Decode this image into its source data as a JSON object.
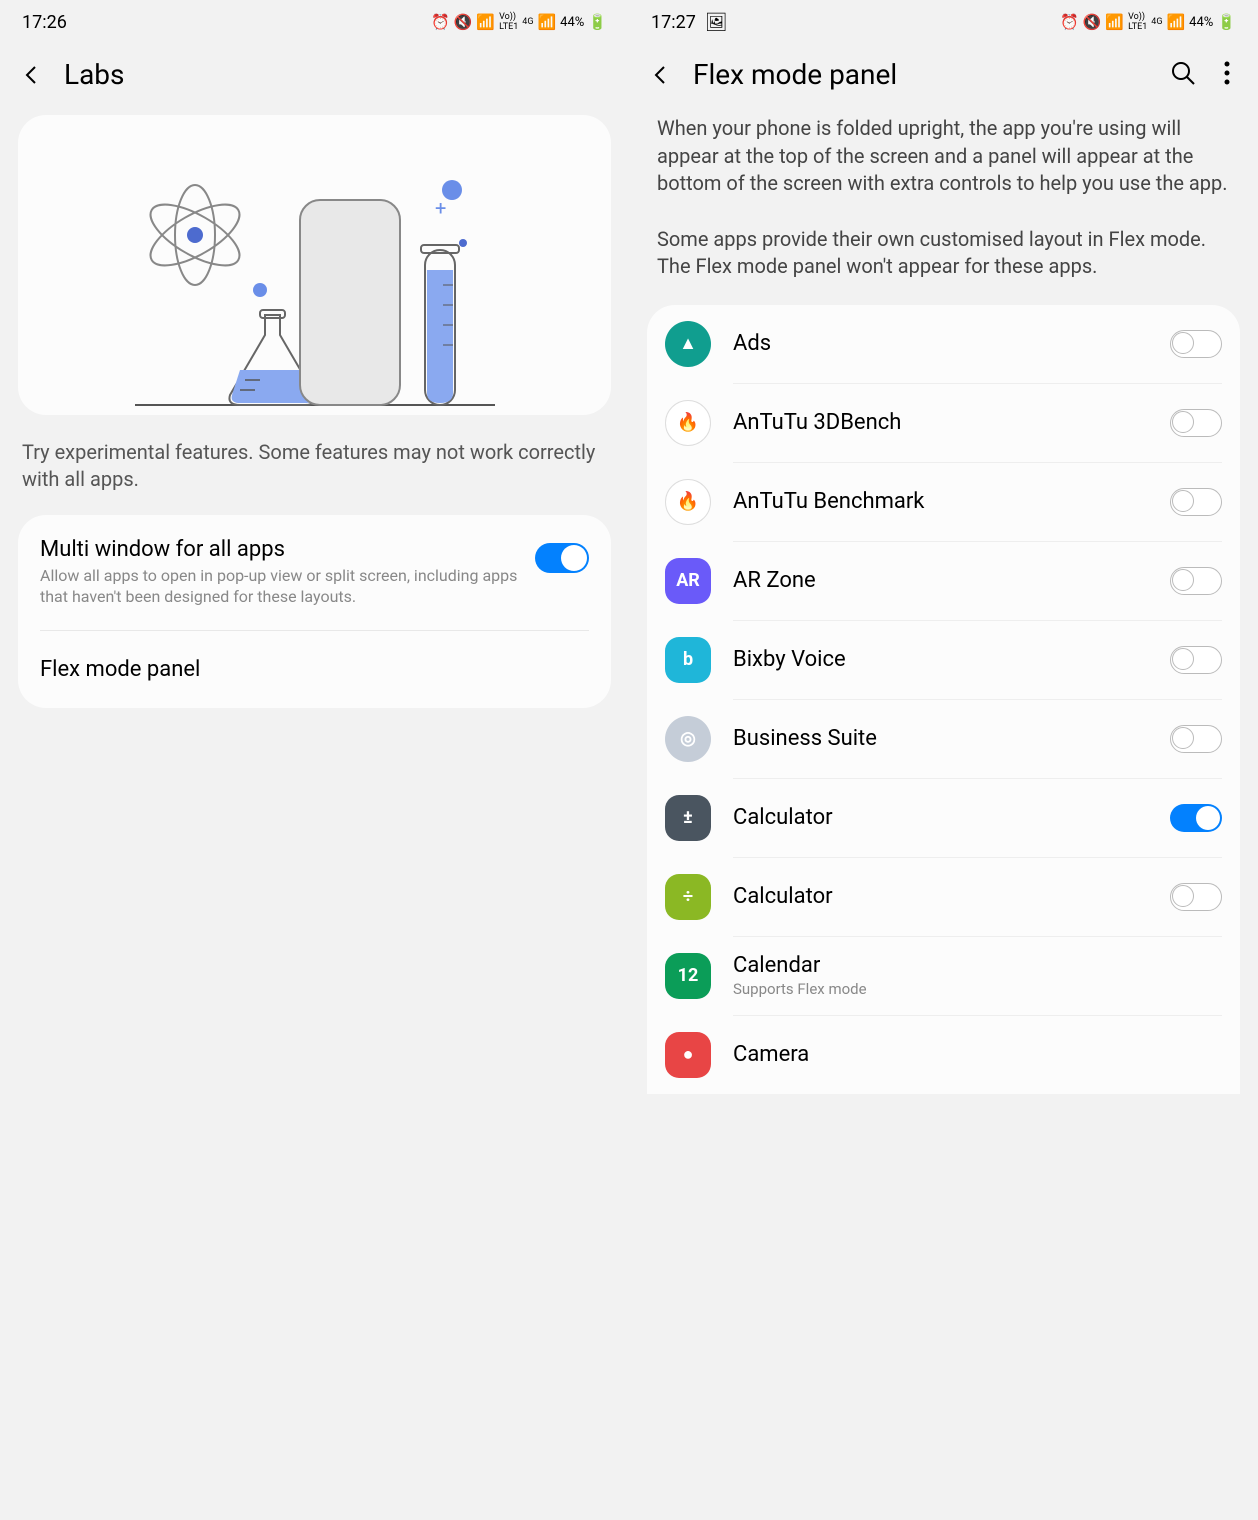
{
  "left": {
    "statusbar": {
      "time": "17:26",
      "battery": "44%"
    },
    "title": "Labs",
    "description": "Try experimental features. Some features may not work correctly with all apps.",
    "settings": {
      "multi": {
        "title": "Multi window for all apps",
        "sub": "Allow all apps to open in pop-up view or split screen, including apps that haven't been designed for these layouts.",
        "on": true
      },
      "flex": {
        "title": "Flex mode panel"
      }
    }
  },
  "right": {
    "statusbar": {
      "time": "17:27",
      "battery": "44%"
    },
    "title": "Flex mode panel",
    "desc1": "When your phone is folded upright, the app you're using will appear at the top of the screen and a panel will appear at the bottom of the screen with extra controls to help you use the app.",
    "desc2": "Some apps provide their own customised layout in Flex mode. The Flex mode panel won't appear for these apps.",
    "apps": [
      {
        "name": "Ads",
        "on": false,
        "iconBg": "#109e8f",
        "iconText": "▲",
        "shape": "circle"
      },
      {
        "name": "AnTuTu 3DBench",
        "on": false,
        "iconBg": "#fff",
        "iconText": "🔥",
        "shape": "circle",
        "border": true
      },
      {
        "name": "AnTuTu Benchmark",
        "on": false,
        "iconBg": "#fff",
        "iconText": "🔥",
        "shape": "circle",
        "border": true
      },
      {
        "name": "AR Zone",
        "on": false,
        "iconBg": "#6a5af9",
        "iconText": "AR",
        "shape": "squircle"
      },
      {
        "name": "Bixby Voice",
        "on": false,
        "iconBg": "#1fb6d9",
        "iconText": "b",
        "shape": "squircle"
      },
      {
        "name": "Business Suite",
        "on": false,
        "iconBg": "#c5cdd8",
        "iconText": "◎",
        "shape": "circle"
      },
      {
        "name": "Calculator",
        "on": true,
        "iconBg": "#4a5560",
        "iconText": "±",
        "shape": "squircle"
      },
      {
        "name": "Calculator",
        "on": false,
        "iconBg": "#8bb824",
        "iconText": "÷",
        "shape": "squircle"
      },
      {
        "name": "Calendar",
        "sub": "Supports Flex mode",
        "on": false,
        "iconBg": "#0b9d58",
        "iconText": "12",
        "shape": "squircle",
        "noToggle": true
      },
      {
        "name": "Camera",
        "on": false,
        "iconBg": "#e84545",
        "iconText": "●",
        "shape": "squircle",
        "noToggle": true
      }
    ]
  }
}
